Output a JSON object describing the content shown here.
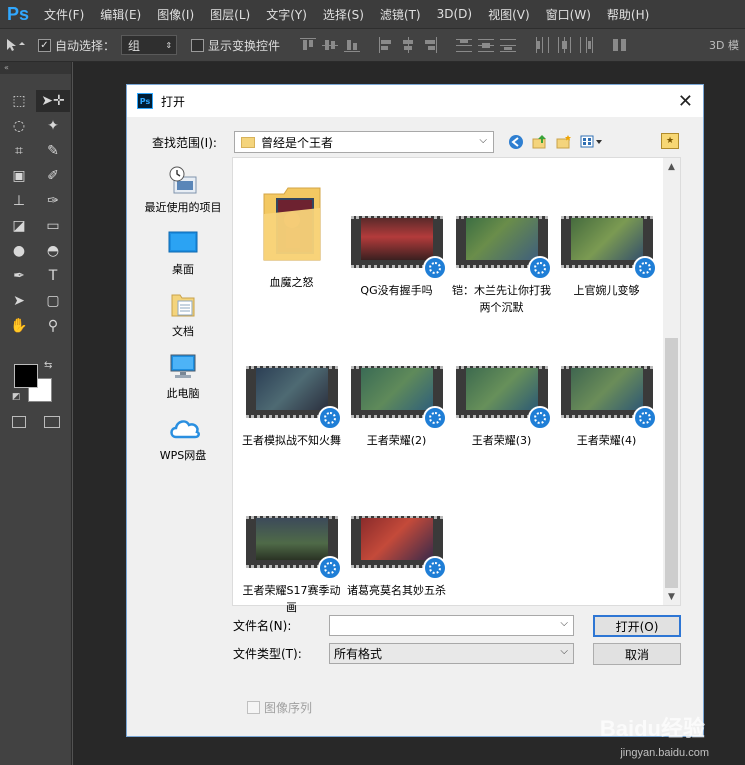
{
  "app": {
    "logo": "Ps",
    "menus": [
      "文件(F)",
      "编辑(E)",
      "图像(I)",
      "图层(L)",
      "文字(Y)",
      "选择(S)",
      "滤镜(T)",
      "3D(D)",
      "视图(V)",
      "窗口(W)",
      "帮助(H)"
    ]
  },
  "options": {
    "auto_select_label": "自动选择：",
    "auto_select_value": "组",
    "show_transform_label": "显示变换控件",
    "mode_3d": "3D 模"
  },
  "dialog": {
    "title": "打开",
    "look_in_label": "查找范围(I):",
    "look_in_value": "曾经是个王者",
    "places": [
      {
        "label": "最近使用的项目",
        "icon": "recent-items-icon"
      },
      {
        "label": "桌面",
        "icon": "desktop-icon"
      },
      {
        "label": "文档",
        "icon": "documents-icon"
      },
      {
        "label": "此电脑",
        "icon": "this-pc-icon"
      },
      {
        "label": "WPS网盘",
        "icon": "wps-cloud-icon"
      }
    ],
    "files": [
      {
        "label": "血魔之怒",
        "type": "folder"
      },
      {
        "label": "QG没有握手吗",
        "type": "video"
      },
      {
        "label": "铠：木兰先让你打我两个沉默",
        "type": "video"
      },
      {
        "label": "上官婉儿变够",
        "type": "video"
      },
      {
        "label": "王者模拟战不知火舞",
        "type": "video"
      },
      {
        "label": "王者荣耀(2)",
        "type": "video"
      },
      {
        "label": "王者荣耀(3)",
        "type": "video"
      },
      {
        "label": "王者荣耀(4)",
        "type": "video"
      },
      {
        "label": "王者荣耀S17赛季动画",
        "type": "video"
      },
      {
        "label": "诸葛亮莫名其妙五杀",
        "type": "video"
      }
    ],
    "filename_label": "文件名(N):",
    "filename_value": "",
    "filetype_label": "文件类型(T):",
    "filetype_value": "所有格式",
    "open_button": "打开(O)",
    "cancel_button": "取消",
    "image_sequence_label": "图像序列"
  },
  "watermark": {
    "brand": "Baidu经验",
    "url": "jingyan.baidu.com"
  },
  "colors": {
    "ps_blue": "#31a8ff",
    "menubar": "#3c3c3c",
    "dialog_border": "#7aa7d6",
    "badge_blue": "#1f7ed6",
    "folder_yellow": "#f4d47c"
  }
}
